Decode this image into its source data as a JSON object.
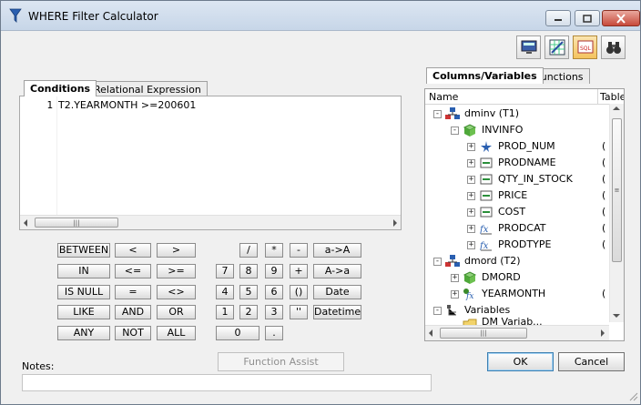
{
  "window": {
    "title": "WHERE Filter Calculator"
  },
  "left_tabs": [
    "Conditions",
    "Relational Expression"
  ],
  "editor": {
    "line_number": "1",
    "code": "T2.YEARMONTH >=200601"
  },
  "keypad": {
    "row1": [
      "BETWEEN",
      "<",
      ">",
      "/",
      "*",
      "-",
      "a->A"
    ],
    "row2": [
      "IN",
      "<=",
      ">=",
      "7",
      "8",
      "9",
      "+",
      "A->a"
    ],
    "row3": [
      "IS NULL",
      "=",
      "<>",
      "4",
      "5",
      "6",
      "()",
      "Date"
    ],
    "row4": [
      "LIKE",
      "AND",
      "OR",
      "1",
      "2",
      "3",
      "''",
      "Datetime"
    ],
    "row5": [
      "ANY",
      "NOT",
      "ALL",
      "0",
      "."
    ]
  },
  "function_assist": "Function Assist",
  "notes": {
    "label": "Notes:",
    "value": ""
  },
  "right_tabs": [
    "Columns/Variables",
    "Functions"
  ],
  "tree_header": {
    "name": "Name",
    "table": "Table"
  },
  "tree": {
    "dminv": "dminv (T1)",
    "invinfo": "INVINFO",
    "columns": [
      {
        "name": "PROD_NUM",
        "table": "("
      },
      {
        "name": "PRODNAME",
        "table": "("
      },
      {
        "name": "QTY_IN_STOCK",
        "table": "("
      },
      {
        "name": "PRICE",
        "table": "("
      },
      {
        "name": "COST",
        "table": "("
      },
      {
        "name": "PRODCAT",
        "table": "("
      },
      {
        "name": "PRODTYPE",
        "table": "("
      }
    ],
    "dmord": "dmord (T2)",
    "dmord_children": [
      {
        "name": "DMORD",
        "table": ""
      },
      {
        "name": "YEARMONTH",
        "table": "("
      }
    ],
    "variables": "Variables",
    "variables_child": "DM Variab..."
  },
  "buttons": {
    "ok": "OK",
    "cancel": "Cancel"
  },
  "colors": {
    "accent": "#3c7fb1",
    "title_bg": "#dce6f2",
    "close": "#c7493a"
  }
}
